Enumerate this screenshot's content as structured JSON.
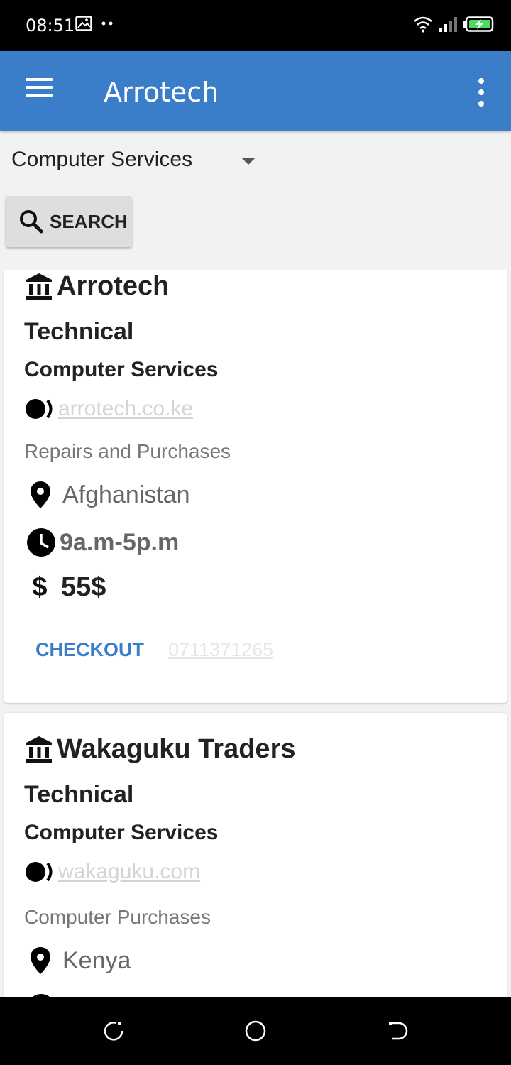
{
  "status_bar": {
    "time": "08:51"
  },
  "app_bar": {
    "title": "Arrotech"
  },
  "filter": {
    "selected_category": "Computer Services",
    "search_label": "SEARCH"
  },
  "listings": [
    {
      "name": "Arrotech",
      "type": "Technical",
      "category": "Computer Services",
      "website": "arrotech.co.ke",
      "description": "Repairs and Purchases",
      "location": "Afghanistan",
      "hours": "9a.m-5p.m",
      "price_symbol": "$",
      "price": "55$",
      "checkout_label": "CHECKOUT",
      "phone": "0711371265"
    },
    {
      "name": "Wakaguku Traders",
      "type": "Technical",
      "category": "Computer Services",
      "website": "wakaguku.com",
      "description": "Computer Purchases",
      "location": "Kenya"
    }
  ],
  "colors": {
    "app_bar": "#3a7dc9",
    "accent_link": "#3a7dc9",
    "status_bar": "#000000"
  }
}
